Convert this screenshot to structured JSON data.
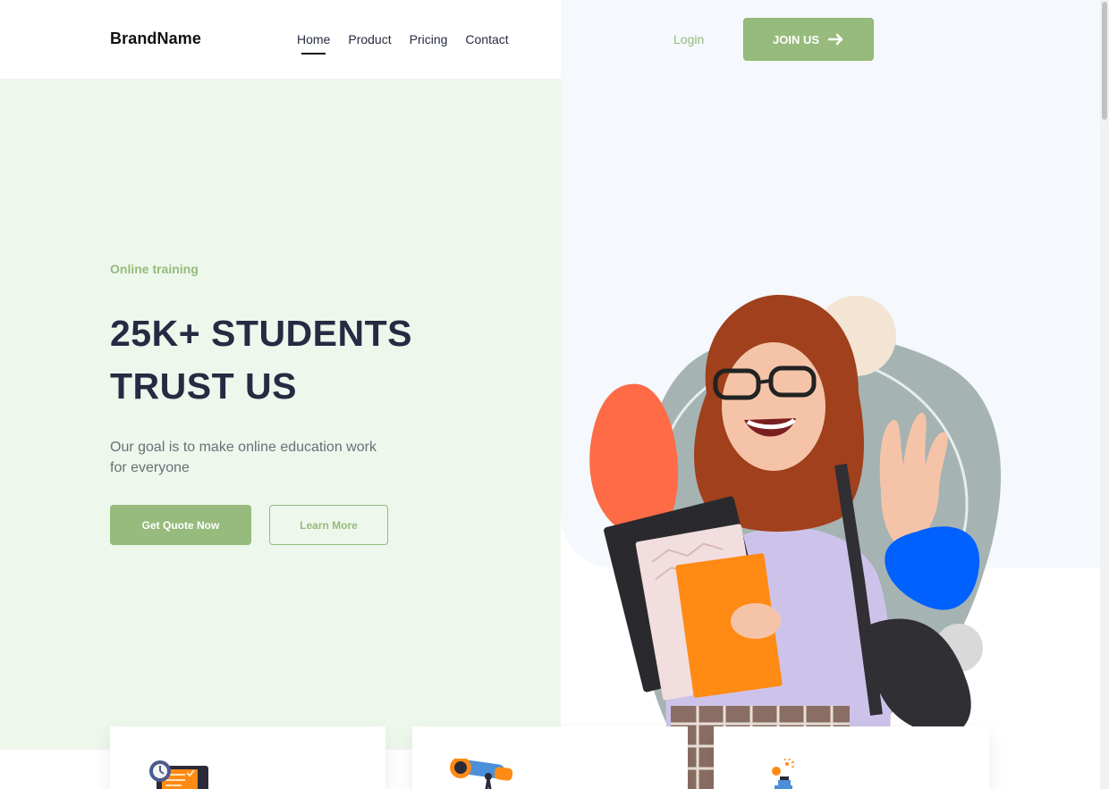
{
  "header": {
    "brand": "BrandName",
    "nav": [
      "Home",
      "Product",
      "Pricing",
      "Contact"
    ],
    "active_nav": "Home",
    "login": "Login",
    "join_label": "JOIN US",
    "join_icon": "arrow-right-icon"
  },
  "hero": {
    "eyebrow": "Online training",
    "headline_line1": "25K+ STUDENTS",
    "headline_line2": "TRUST US",
    "subtext": "Our goal is to make online education work for everyone",
    "primary_cta": "Get Quote Now",
    "secondary_cta": "Learn More",
    "image": "smiling-student-with-notebooks"
  },
  "cards": [
    {
      "icon": "dashboard-checklist-icon"
    },
    {
      "icon": "telescope-icon"
    },
    {
      "icon": "microscope-icon"
    }
  ],
  "colors": {
    "accent": "#96bb7c",
    "dark_text": "#252b42",
    "left_bg": "#eef7ec",
    "right_bg": "#f5f8fc",
    "shape_orange": "#ff6b47",
    "shape_blue": "#0061ff",
    "shape_peach": "#f3e4d4",
    "shape_gray": "#a5b3b3"
  }
}
